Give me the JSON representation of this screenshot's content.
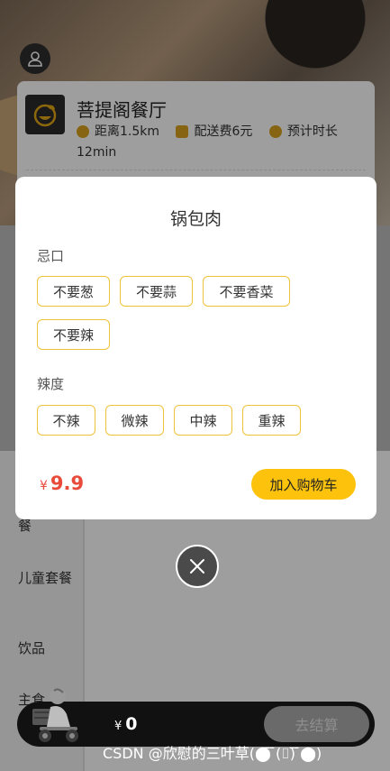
{
  "shop": {
    "name": "菩提阁餐厅",
    "distance": "距离1.5km",
    "delivery_fee": "配送费6元",
    "eta_label": "预计时长",
    "eta_value": "12min"
  },
  "categories": [
    "餐",
    "儿童套餐",
    "饮品",
    "主食"
  ],
  "modal": {
    "title": "锅包肉",
    "groups": [
      {
        "label": "忌口",
        "options": [
          "不要葱",
          "不要蒜",
          "不要香菜",
          "不要辣"
        ]
      },
      {
        "label": "辣度",
        "options": [
          "不辣",
          "微辣",
          "中辣",
          "重辣"
        ]
      }
    ],
    "currency": "¥",
    "price": "9.9",
    "add_label": "加入购物车"
  },
  "cart": {
    "currency": "¥",
    "total": "0",
    "checkout_label": "去结算"
  },
  "watermark": "CSDN @欣慰的三叶草(⬤̄ ̄(⌷)̄ ̄⬤)",
  "colors": {
    "accent": "#fcc20c",
    "price": "#e84b3a",
    "option_border": "#f0c23a"
  }
}
